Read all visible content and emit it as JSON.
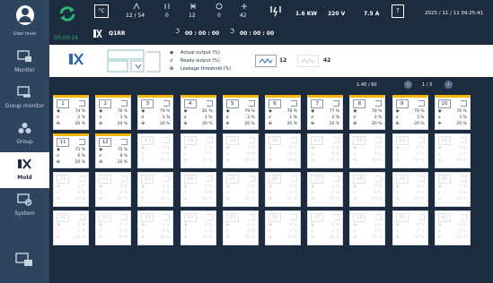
{
  "user": {
    "label": "User level"
  },
  "nav": [
    {
      "label": "Monitor"
    },
    {
      "label": "Group monitor"
    },
    {
      "label": "Group"
    },
    {
      "label": "Mold"
    },
    {
      "label": "System"
    }
  ],
  "status": {
    "timer": "00:00:14",
    "temp_unit": "°C",
    "counts": [
      {
        "top": "12 / 54"
      },
      {
        "top": "0"
      },
      {
        "top": "12"
      },
      {
        "top": "0"
      },
      {
        "top": "42"
      }
    ],
    "power": "1.6 KW",
    "voltage": "220 V",
    "current": "7.5 A",
    "help": "?",
    "datetime": "2025 / 11 / 11  09:25:41"
  },
  "mold": {
    "name": "Q1RR",
    "time1": "00 : 00 : 00",
    "time2": "00 : 00 : 00"
  },
  "legend": {
    "actual": "Actual output (%)",
    "ready": "Ready output (%)",
    "leak": "Leakage threshold  (%)",
    "count_a": "12",
    "count_b": "42"
  },
  "pager": {
    "range": "1-40 / 60",
    "page": "1 / 3"
  },
  "zones": [
    {
      "n": "1",
      "a": "74 %",
      "b": "2 %",
      "c": "20 %",
      "on": true
    },
    {
      "n": "2",
      "a": "76 %",
      "b": "1 %",
      "c": "20 %",
      "on": true
    },
    {
      "n": "3",
      "a": "79 %",
      "b": "1 %",
      "c": "20 %",
      "on": true
    },
    {
      "n": "4",
      "a": "81 %",
      "b": "1 %",
      "c": "20 %",
      "on": true
    },
    {
      "n": "5",
      "a": "79 %",
      "b": "2 %",
      "c": "20 %",
      "on": true
    },
    {
      "n": "6",
      "a": "78 %",
      "b": "1 %",
      "c": "20 %",
      "on": true
    },
    {
      "n": "7",
      "a": "77 %",
      "b": "2 %",
      "c": "20 %",
      "on": true
    },
    {
      "n": "8",
      "a": "78 %",
      "b": "2 %",
      "c": "20 %",
      "on": true
    },
    {
      "n": "9",
      "a": "78 %",
      "b": "3 %",
      "c": "20 %",
      "on": true
    },
    {
      "n": "10",
      "a": "76 %",
      "b": "3 %",
      "c": "20 %",
      "on": true
    },
    {
      "n": "11",
      "a": "75 %",
      "b": "6 %",
      "c": "20 %",
      "on": true
    },
    {
      "n": "12",
      "a": "75 %",
      "b": "6 %",
      "c": "20 %",
      "on": true
    },
    {
      "n": "13",
      "a": "0 %",
      "b": "0 %",
      "c": "20 %",
      "on": false
    },
    {
      "n": "14",
      "a": "0 %",
      "b": "0 %",
      "c": "20 %",
      "on": false
    },
    {
      "n": "15",
      "a": "0 %",
      "b": "0 %",
      "c": "20 %",
      "on": false
    },
    {
      "n": "16",
      "a": "0 %",
      "b": "0 %",
      "c": "20 %",
      "on": false
    },
    {
      "n": "17",
      "a": "0 %",
      "b": "0 %",
      "c": "20 %",
      "on": false
    },
    {
      "n": "18",
      "a": "0 %",
      "b": "0 %",
      "c": "20 %",
      "on": false
    },
    {
      "n": "19",
      "a": "0 %",
      "b": "0 %",
      "c": "20 %",
      "on": false
    },
    {
      "n": "20",
      "a": "0 %",
      "b": "0 %",
      "c": "20 %",
      "on": false
    },
    {
      "n": "21",
      "a": "0 %",
      "b": "0 %",
      "c": "20 %",
      "on": false
    },
    {
      "n": "22",
      "a": "0 %",
      "b": "0 %",
      "c": "20 %",
      "on": false
    },
    {
      "n": "23",
      "a": "0 %",
      "b": "0 %",
      "c": "20 %",
      "on": false
    },
    {
      "n": "24",
      "a": "0 %",
      "b": "0 %",
      "c": "20 %",
      "on": false
    },
    {
      "n": "25",
      "a": "0 %",
      "b": "0 %",
      "c": "20 %",
      "on": false
    },
    {
      "n": "26",
      "a": "0 %",
      "b": "0 %",
      "c": "20 %",
      "on": false
    },
    {
      "n": "27",
      "a": "0 %",
      "b": "0 %",
      "c": "20 %",
      "on": false
    },
    {
      "n": "28",
      "a": "0 %",
      "b": "0 %",
      "c": "20 %",
      "on": false
    },
    {
      "n": "29",
      "a": "0 %",
      "b": "0 %",
      "c": "20 %",
      "on": false
    },
    {
      "n": "30",
      "a": "0 %",
      "b": "0 %",
      "c": "20 %",
      "on": false
    },
    {
      "n": "31",
      "a": "0 %",
      "b": "0 %",
      "c": "20 %",
      "on": false
    },
    {
      "n": "32",
      "a": "0 %",
      "b": "0 %",
      "c": "20 %",
      "on": false
    },
    {
      "n": "33",
      "a": "0 %",
      "b": "0 %",
      "c": "20 %",
      "on": false
    },
    {
      "n": "34",
      "a": "0 %",
      "b": "0 %",
      "c": "20 %",
      "on": false
    },
    {
      "n": "35",
      "a": "0 %",
      "b": "0 %",
      "c": "20 %",
      "on": false
    },
    {
      "n": "36",
      "a": "0 %",
      "b": "0 %",
      "c": "20 %",
      "on": false
    },
    {
      "n": "37",
      "a": "0 %",
      "b": "0 %",
      "c": "20 %",
      "on": false
    },
    {
      "n": "38",
      "a": "0 %",
      "b": "0 %",
      "c": "20 %",
      "on": false
    },
    {
      "n": "39",
      "a": "0 %",
      "b": "0 %",
      "c": "20 %",
      "on": false
    },
    {
      "n": "40",
      "a": "0 %",
      "b": "0 %",
      "c": "20 %",
      "on": false
    }
  ],
  "colors": {
    "accent": "#f5b400",
    "ok": "#2bb673",
    "panel": "#2e4560"
  }
}
